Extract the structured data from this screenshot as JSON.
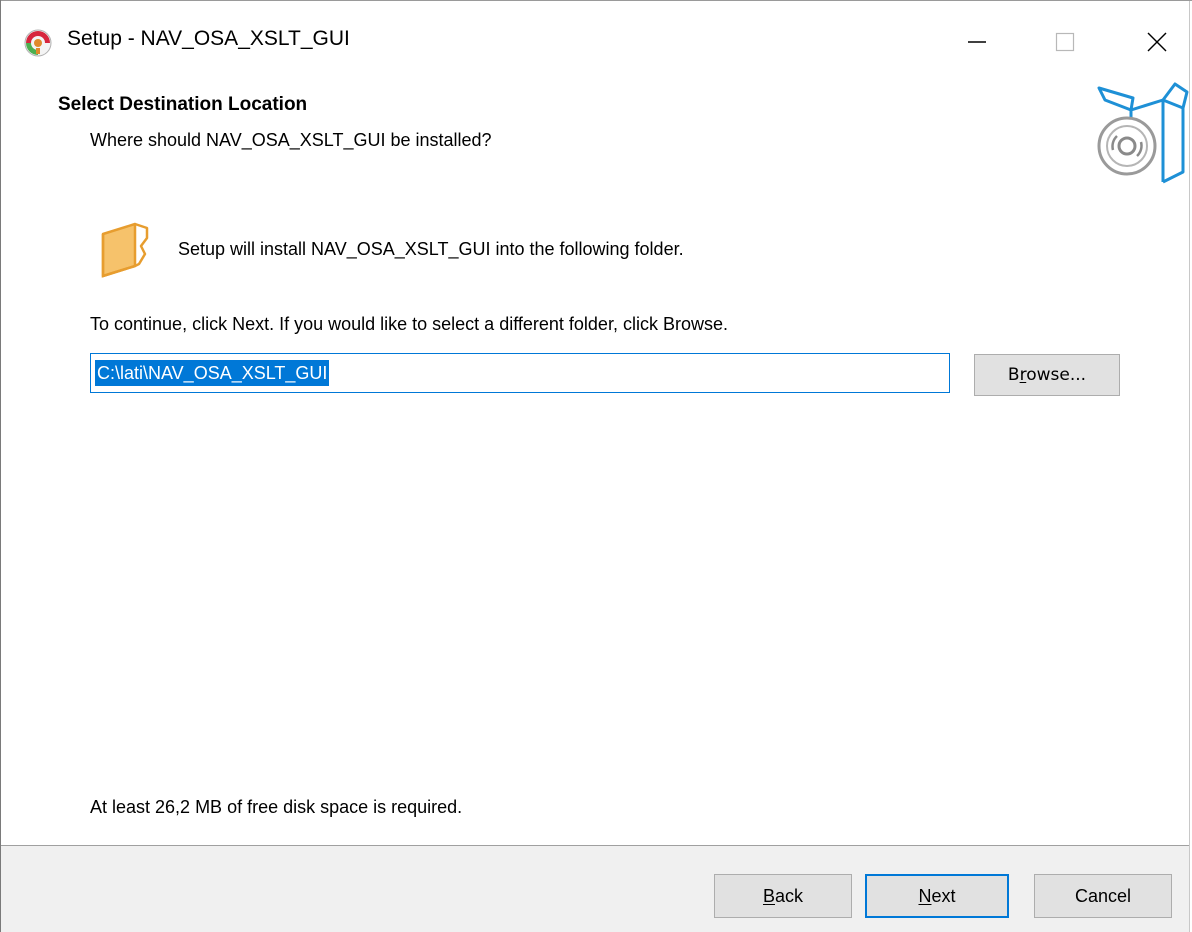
{
  "window": {
    "title": "Setup - NAV_OSA_XSLT_GUI",
    "controls": {
      "minimize_icon": "minimize-icon",
      "maximize_icon": "maximize-icon",
      "close_icon": "close-icon"
    }
  },
  "header": {
    "title": "Select Destination Location",
    "subtitle": "Where should NAV_OSA_XSLT_GUI be installed?",
    "art_icon": "installer-box-disc-icon"
  },
  "content": {
    "folder_icon": "folder-icon",
    "install_text": "Setup will install NAV_OSA_XSLT_GUI into the following folder.",
    "continue_text": "To continue, click Next. If you would like to select a different folder, click Browse.",
    "path_value": "C:\\lati\\NAV_OSA_XSLT_GUI",
    "browse_label": "Browse...",
    "diskspace_text": "At least 26,2 MB of free disk space is required."
  },
  "footer": {
    "back_label": "Back",
    "next_label": "Next",
    "cancel_label": "Cancel"
  },
  "colors": {
    "accent": "#0078d7",
    "folder": "#f6c26b",
    "art": "#1e90d6",
    "footer_bg": "#f0f0f0",
    "button_bg": "#e1e1e1"
  }
}
